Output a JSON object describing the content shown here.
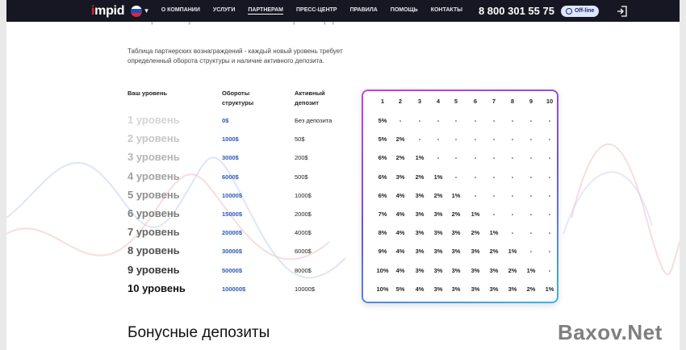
{
  "header": {
    "logo_prefix": "i",
    "logo_rest": "mpid",
    "nav": [
      "О КОМПАНИИ",
      "УСЛУГИ",
      "ПАРТНЕРАМ",
      "ПРЕСС-ЦЕНТР",
      "ПРАВИЛА",
      "ПОМОЩЬ",
      "КОНТАКТЫ"
    ],
    "active_nav": "ПАРТНЕРАМ",
    "phone": "8 800 301 55 75",
    "status": "Off-line",
    "accent": "#e32636",
    "bar_color": "#161722"
  },
  "main": {
    "title": "Партнерское вознаграждение",
    "description": "Таблица партнерских вознаграждений - каждый новый уровень требует определенный оборота структуры и наличие активного депозита.",
    "columns": {
      "level": "Ваш уровень",
      "turnover": "Обороты структуры",
      "deposit": "Активный депозит"
    },
    "grid_headers": [
      "1",
      "2",
      "3",
      "4",
      "5",
      "6",
      "7",
      "8",
      "9",
      "10"
    ],
    "rows": [
      {
        "level": "1 уровень",
        "turnover": "0$",
        "deposit": "Без депозита",
        "rates": [
          "5%",
          "-",
          "-",
          "-",
          "-",
          "-",
          "-",
          "-",
          "-",
          "-"
        ]
      },
      {
        "level": "2 уровень",
        "turnover": "1000$",
        "deposit": "50$",
        "rates": [
          "5%",
          "2%",
          "-",
          "-",
          "-",
          "-",
          "-",
          "-",
          "-",
          "-"
        ]
      },
      {
        "level": "3 уровень",
        "turnover": "3000$",
        "deposit": "200$",
        "rates": [
          "6%",
          "2%",
          "1%",
          "-",
          "-",
          "-",
          "-",
          "-",
          "-",
          "-"
        ]
      },
      {
        "level": "4 уровень",
        "turnover": "6000$",
        "deposit": "500$",
        "rates": [
          "6%",
          "3%",
          "2%",
          "1%",
          "-",
          "-",
          "-",
          "-",
          "-",
          "-"
        ]
      },
      {
        "level": "5 уровень",
        "turnover": "10000$",
        "deposit": "1000$",
        "rates": [
          "6%",
          "4%",
          "3%",
          "2%",
          "1%",
          "-",
          "-",
          "-",
          "-",
          "-"
        ]
      },
      {
        "level": "6 уровень",
        "turnover": "15000$",
        "deposit": "2000$",
        "rates": [
          "7%",
          "4%",
          "3%",
          "3%",
          "2%",
          "1%",
          "-",
          "-",
          "-",
          "-"
        ]
      },
      {
        "level": "7 уровень",
        "turnover": "20000$",
        "deposit": "4000$",
        "rates": [
          "8%",
          "4%",
          "3%",
          "3%",
          "3%",
          "2%",
          "1%",
          "-",
          "-",
          "-"
        ]
      },
      {
        "level": "8 уровень",
        "turnover": "30000$",
        "deposit": "6000$",
        "rates": [
          "9%",
          "4%",
          "3%",
          "3%",
          "3%",
          "3%",
          "2%",
          "1%",
          "-",
          "-"
        ]
      },
      {
        "level": "9 уровень",
        "turnover": "50000$",
        "deposit": "8000$",
        "rates": [
          "10%",
          "4%",
          "3%",
          "3%",
          "3%",
          "3%",
          "3%",
          "2%",
          "1%",
          "-"
        ]
      },
      {
        "level": "10 уровень",
        "turnover": "100000$",
        "deposit": "10000$",
        "rates": [
          "10%",
          "5%",
          "4%",
          "3%",
          "3%",
          "3%",
          "3%",
          "3%",
          "2%",
          "1%"
        ]
      }
    ],
    "level_colors": [
      "#d4d4d4",
      "#c6c6c6",
      "#b5b5b5",
      "#a3a3a3",
      "#909090",
      "#7c7c7c",
      "#666666",
      "#505050",
      "#383838",
      "#111111"
    ],
    "turnover_color": "#2b58b8"
  },
  "bonus_title": "Бонусные депозиты",
  "watermark": "Baxov.Net"
}
